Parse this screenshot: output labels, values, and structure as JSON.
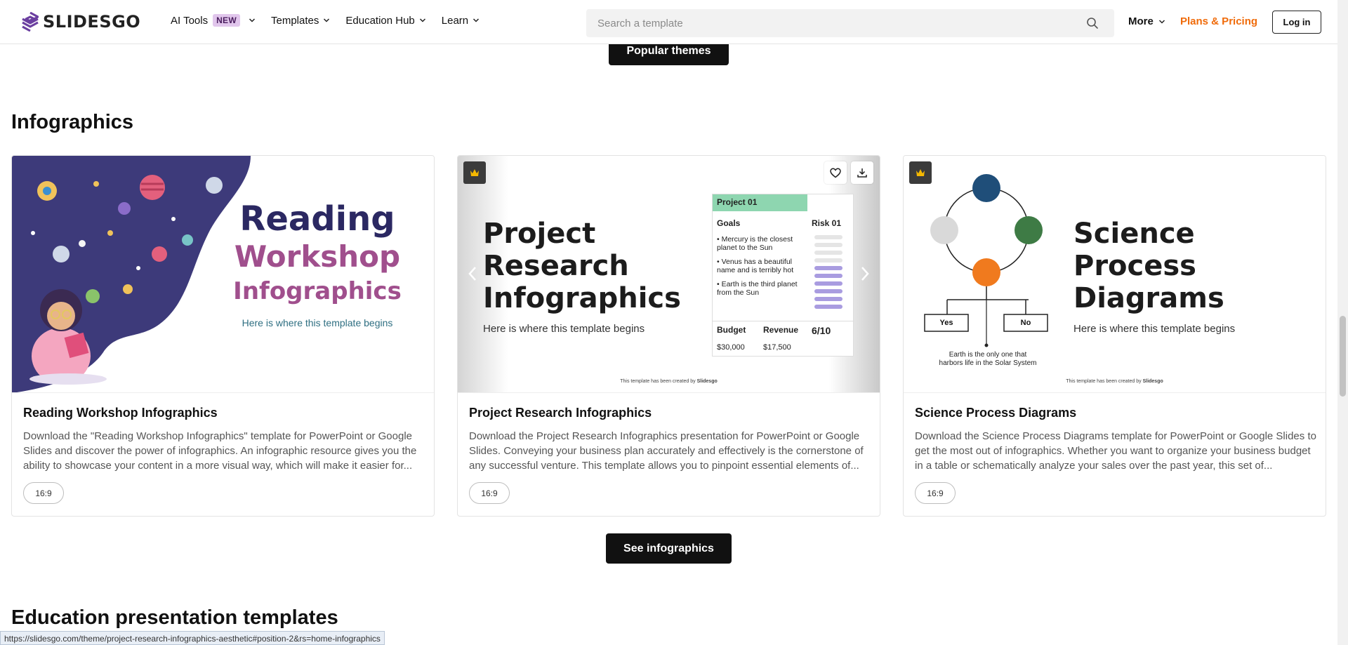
{
  "header": {
    "logo_text": "SLIDESGO",
    "nav": [
      {
        "label": "AI Tools",
        "badge": "NEW"
      },
      {
        "label": "Templates"
      },
      {
        "label": "Education Hub"
      },
      {
        "label": "Learn"
      }
    ],
    "search_placeholder": "Search a template",
    "more_label": "More",
    "pricing_label": "Plans & Pricing",
    "login_label": "Log in"
  },
  "popular_button": "Popular themes",
  "infographics": {
    "title": "Infographics",
    "cards": [
      {
        "title": "Reading Workshop Infographics",
        "description": "Download the \"Reading Workshop Infographics\" template for PowerPoint or Google Slides and discover the power of infographics. An infographic resource gives you the ability to showcase your content in a more visual way, which will make it easier for...",
        "ratio": "16:9",
        "thumb": {
          "line1": "Reading",
          "line2": "Workshop",
          "line3": "Infographics",
          "subtitle": "Here is where this template begins"
        }
      },
      {
        "title": "Project Research Infographics",
        "description": "Download the Project Research Infographics presentation for PowerPoint or Google Slides. Conveying your business plan accurately and effectively is the cornerstone of any successful venture. This template allows you to pinpoint essential elements of...",
        "ratio": "16:9",
        "thumb": {
          "line1": "Project",
          "line2": "Research",
          "line3": "Infographics",
          "subtitle": "Here is where this template begins",
          "table_header": "Project 01",
          "goals_label": "Goals",
          "risk_label": "Risk 01",
          "goals": [
            "Mercury is the closest planet to the Sun",
            "Venus has a beautiful name and is terribly hot",
            "Earth is the third planet from the Sun"
          ],
          "budget_label": "Budget",
          "revenue_label": "Revenue",
          "score": "6/10",
          "budget_value": "$30,000",
          "revenue_value": "$17,500",
          "credit": "This template has been created by",
          "credit_brand": "Slidesgo"
        }
      },
      {
        "title": "Science Process Diagrams",
        "description": "Download the Science Process Diagrams template for PowerPoint or Google Slides to get the most out of infographics. Whether you want to organize your business budget in a table or schematically analyze your sales over the past year, this set of...",
        "ratio": "16:9",
        "thumb": {
          "line1": "Science",
          "line2": "Process",
          "line3": "Diagrams",
          "subtitle": "Here is where this template begins",
          "yes": "Yes",
          "no": "No",
          "caption1": "Earth is the only one that",
          "caption2": "harbors life in the Solar System",
          "credit": "This template has been created by",
          "credit_brand": "Slidesgo"
        }
      }
    ],
    "see_button": "See infographics"
  },
  "education_title": "Education presentation templates",
  "status_url": "https://slidesgo.com/theme/project-research-infographics-aesthetic#position-2&rs=home-infographics",
  "colors": {
    "accent": "#f06b0a",
    "dark": "#111111",
    "badge": "#e1c6ec",
    "brand_purple": "#5b2d82"
  }
}
